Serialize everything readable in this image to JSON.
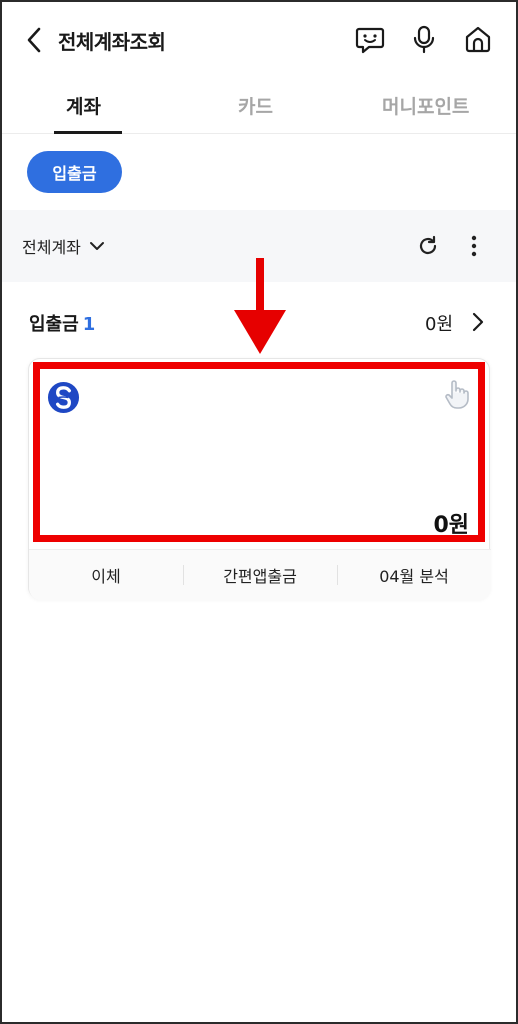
{
  "header": {
    "title": "전체계좌조회",
    "back_icon": "chevron-left-icon",
    "icons": [
      "chat-icon",
      "mic-icon",
      "home-icon"
    ]
  },
  "tabs": [
    {
      "label": "계좌",
      "active": true
    },
    {
      "label": "카드",
      "active": false
    },
    {
      "label": "머니포인트",
      "active": false
    }
  ],
  "filter_chip": {
    "label": "입출금"
  },
  "filter_bar": {
    "select_label": "전체계좌",
    "icons": [
      "refresh-icon",
      "more-vertical-icon"
    ]
  },
  "section": {
    "title": "입출금",
    "count": "1",
    "total": "0원"
  },
  "account_card": {
    "bank_logo": "shinhan-logo",
    "balance": "0원",
    "actions": [
      "이체",
      "간편앱출금",
      "04월 분석"
    ]
  },
  "annotation": {
    "arrow_color": "#e60000",
    "box_color": "#ee0000"
  },
  "colors": {
    "accent": "#2f6fe0",
    "text_primary": "#1a1a1a",
    "text_muted": "#a6a6a6"
  }
}
